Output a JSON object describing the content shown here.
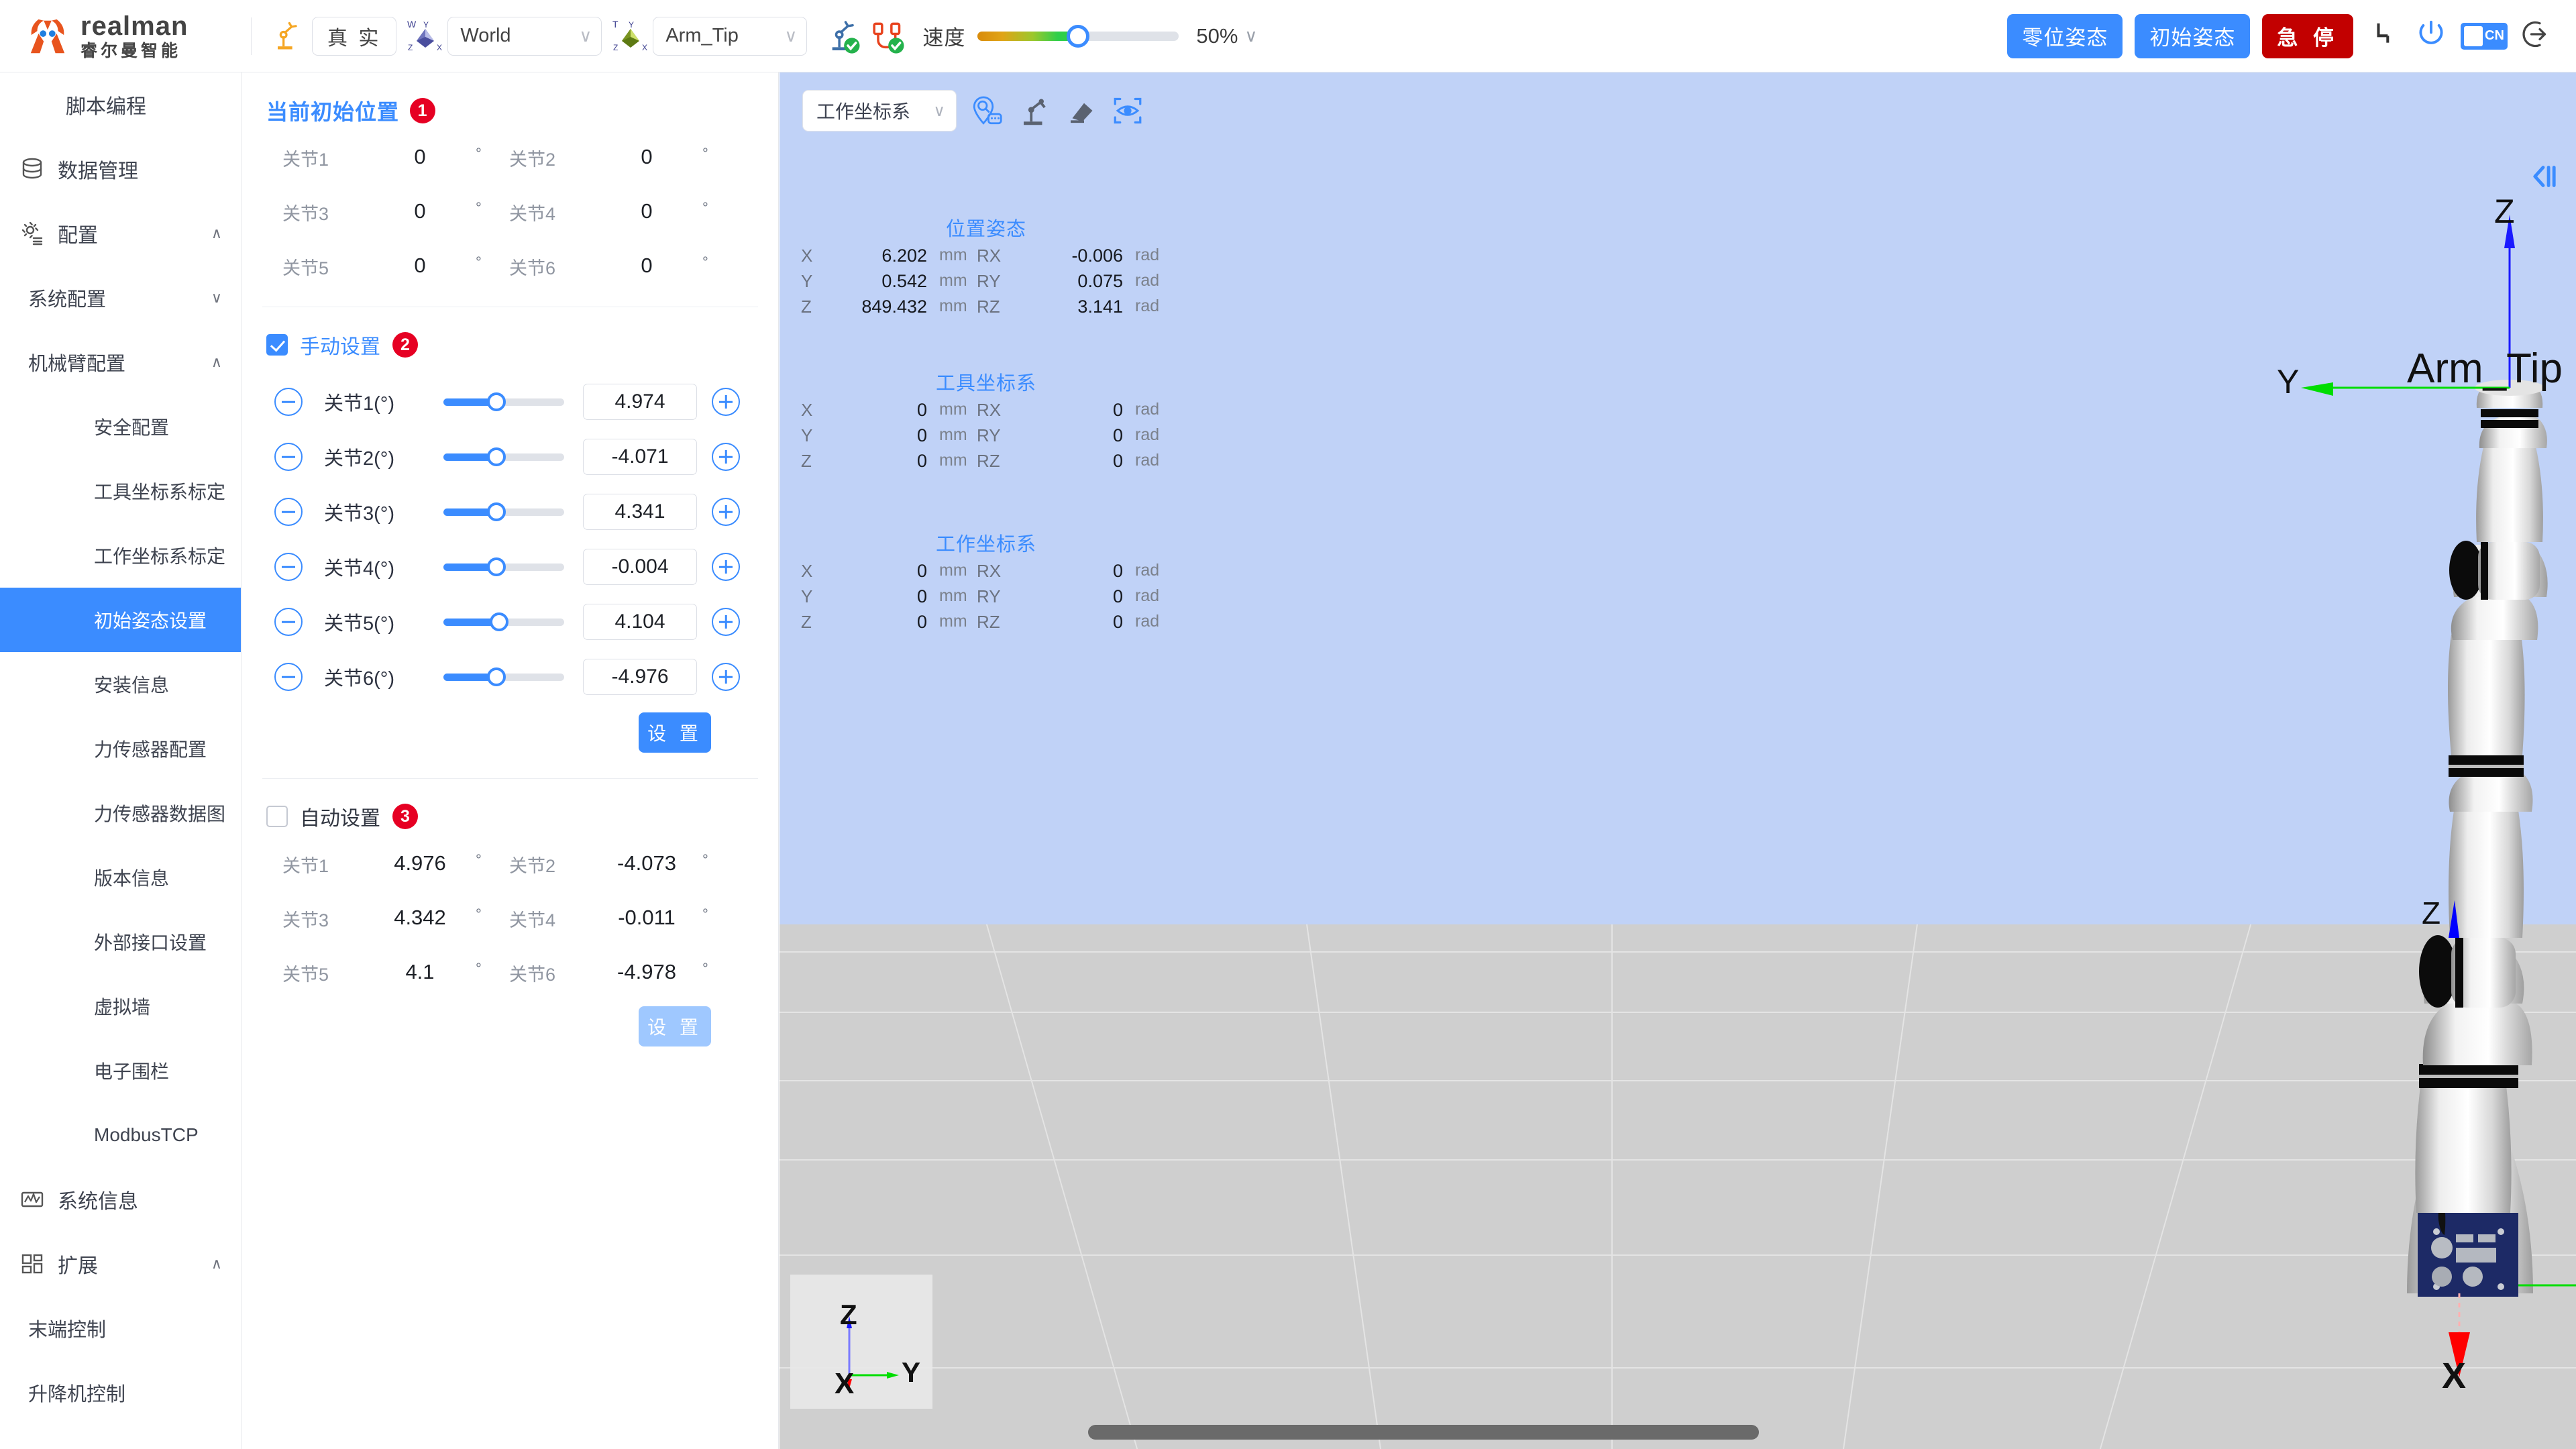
{
  "brand": {
    "name_en": "realman",
    "name_cn": "睿尔曼智能",
    "logo_icon": "realman-logo-icon"
  },
  "toolbar": {
    "robot_icon": "robot-arm-icon",
    "mode_button": "真 实",
    "world_frame": {
      "badge": "W",
      "icon": "world-axis-icon",
      "value": "World",
      "caret": "∨"
    },
    "tool_frame": {
      "badge": "T",
      "icon": "tool-axis-icon",
      "value": "Arm_Tip",
      "caret": "∨"
    },
    "status_icons": [
      {
        "name": "robot-connected-icon",
        "state": "ok"
      },
      {
        "name": "cable-connected-icon",
        "state": "ok"
      }
    ],
    "speed_label": "速度",
    "speed_value": "50%",
    "speed_percent": 50,
    "speed_caret": "∨",
    "actions": {
      "zero_pose": "零位姿态",
      "initial_pose": "初始姿态",
      "emergency_stop": "急 停"
    },
    "right_icons": [
      "joint-corner-icon",
      "power-icon",
      "language-toggle-icon",
      "logout-icon"
    ],
    "language": "CN"
  },
  "sidebar": {
    "items": [
      {
        "label": "脚本编程",
        "level": 0,
        "icon": "",
        "chevron": "",
        "active": false
      },
      {
        "label": "数据管理",
        "level": 0,
        "icon": "database-icon",
        "chevron": "",
        "active": false
      },
      {
        "label": "配置",
        "level": 0,
        "icon": "gear-config-icon",
        "chevron": "∧",
        "active": false
      },
      {
        "label": "系统配置",
        "level": 1,
        "icon": "",
        "chevron": "∨",
        "active": false
      },
      {
        "label": "机械臂配置",
        "level": 1,
        "icon": "",
        "chevron": "∧",
        "active": false
      },
      {
        "label": "安全配置",
        "level": 2,
        "icon": "",
        "chevron": "",
        "active": false
      },
      {
        "label": "工具坐标系标定",
        "level": 2,
        "icon": "",
        "chevron": "",
        "active": false
      },
      {
        "label": "工作坐标系标定",
        "level": 2,
        "icon": "",
        "chevron": "",
        "active": false
      },
      {
        "label": "初始姿态设置",
        "level": 2,
        "icon": "",
        "chevron": "",
        "active": true
      },
      {
        "label": "安装信息",
        "level": 2,
        "icon": "",
        "chevron": "",
        "active": false
      },
      {
        "label": "力传感器配置",
        "level": 2,
        "icon": "",
        "chevron": "",
        "active": false
      },
      {
        "label": "力传感器数据图",
        "level": 2,
        "icon": "",
        "chevron": "",
        "active": false
      },
      {
        "label": "版本信息",
        "level": 2,
        "icon": "",
        "chevron": "",
        "active": false
      },
      {
        "label": "外部接口设置",
        "level": 2,
        "icon": "",
        "chevron": "",
        "active": false
      },
      {
        "label": "虚拟墙",
        "level": 2,
        "icon": "",
        "chevron": "",
        "active": false
      },
      {
        "label": "电子围栏",
        "level": 2,
        "icon": "",
        "chevron": "",
        "active": false
      },
      {
        "label": "ModbusTCP",
        "level": 2,
        "icon": "",
        "chevron": "",
        "active": false
      },
      {
        "label": "系统信息",
        "level": 0,
        "icon": "chart-wave-icon",
        "chevron": "",
        "active": false
      },
      {
        "label": "扩展",
        "level": 0,
        "icon": "blocks-icon",
        "chevron": "∧",
        "active": false
      },
      {
        "label": "末端控制",
        "level": 1,
        "icon": "",
        "chevron": "",
        "active": false
      },
      {
        "label": "升降机控制",
        "level": 1,
        "icon": "",
        "chevron": "",
        "active": false
      }
    ]
  },
  "panel": {
    "current_position": {
      "title": "当前初始位置",
      "badge": "1",
      "unit": "°",
      "joints": [
        {
          "label": "关节1",
          "value": "0"
        },
        {
          "label": "关节2",
          "value": "0"
        },
        {
          "label": "关节3",
          "value": "0"
        },
        {
          "label": "关节4",
          "value": "0"
        },
        {
          "label": "关节5",
          "value": "0"
        },
        {
          "label": "关节6",
          "value": "0"
        }
      ]
    },
    "manual": {
      "title": "手动设置",
      "badge": "2",
      "checked": true,
      "set_button": "设 置",
      "sliders": [
        {
          "label": "关节1(°)",
          "value": "4.974",
          "percent": 44
        },
        {
          "label": "关节2(°)",
          "value": "-4.071",
          "percent": 44
        },
        {
          "label": "关节3(°)",
          "value": "4.341",
          "percent": 44
        },
        {
          "label": "关节4(°)",
          "value": "-0.004",
          "percent": 44
        },
        {
          "label": "关节5(°)",
          "value": "4.104",
          "percent": 46
        },
        {
          "label": "关节6(°)",
          "value": "-4.976",
          "percent": 44
        }
      ],
      "minus_icon": "minus-circle-icon",
      "plus_icon": "plus-circle-icon"
    },
    "auto": {
      "title": "自动设置",
      "badge": "3",
      "checked": false,
      "set_button": "设 置",
      "unit": "°",
      "joints": [
        {
          "label": "关节1",
          "value": "4.976"
        },
        {
          "label": "关节2",
          "value": "-4.073"
        },
        {
          "label": "关节3",
          "value": "4.342"
        },
        {
          "label": "关节4",
          "value": "-0.011"
        },
        {
          "label": "关节5",
          "value": "4.1"
        },
        {
          "label": "关节6",
          "value": "-4.978"
        }
      ]
    }
  },
  "viewport": {
    "frame_select": {
      "value": "工作坐标系",
      "caret": "∨"
    },
    "tools": [
      "point-search-icon",
      "robot-model-icon",
      "eraser-icon",
      "focus-eye-icon"
    ],
    "collapse_icon": "collapse-panel-icon",
    "cards": [
      {
        "title": "位置姿态",
        "rows": [
          {
            "axis": "X",
            "value": "6.202",
            "unit": "mm",
            "raxis": "RX",
            "rvalue": "-0.006",
            "runit": "rad"
          },
          {
            "axis": "Y",
            "value": "0.542",
            "unit": "mm",
            "raxis": "RY",
            "rvalue": "0.075",
            "runit": "rad"
          },
          {
            "axis": "Z",
            "value": "849.432",
            "unit": "mm",
            "raxis": "RZ",
            "rvalue": "3.141",
            "runit": "rad"
          }
        ]
      },
      {
        "title": "工具坐标系",
        "rows": [
          {
            "axis": "X",
            "value": "0",
            "unit": "mm",
            "raxis": "RX",
            "rvalue": "0",
            "runit": "rad"
          },
          {
            "axis": "Y",
            "value": "0",
            "unit": "mm",
            "raxis": "RY",
            "rvalue": "0",
            "runit": "rad"
          },
          {
            "axis": "Z",
            "value": "0",
            "unit": "mm",
            "raxis": "RZ",
            "rvalue": "0",
            "runit": "rad"
          }
        ]
      },
      {
        "title": "工作坐标系",
        "rows": [
          {
            "axis": "X",
            "value": "0",
            "unit": "mm",
            "raxis": "RX",
            "rvalue": "0",
            "runit": "rad"
          },
          {
            "axis": "Y",
            "value": "0",
            "unit": "mm",
            "raxis": "RY",
            "rvalue": "0",
            "runit": "rad"
          },
          {
            "axis": "Z",
            "value": "0",
            "unit": "mm",
            "raxis": "RZ",
            "rvalue": "0",
            "runit": "rad"
          }
        ]
      }
    ],
    "scene_labels": {
      "tool_tip": "Arm_Tip",
      "tip_z": "Z",
      "tip_y": "Y",
      "elbow_z": "Z",
      "world_y": "Y",
      "world_x": "X"
    },
    "axis_gizmo": {
      "z": "Z",
      "y": "Y",
      "x": "X"
    },
    "colors": {
      "axis_x": "#ff0000",
      "axis_y": "#00dd00",
      "axis_z": "#1a1aff",
      "sky": "#c0d2f7",
      "ground": "#cfcfcf"
    }
  },
  "colors": {
    "accent": "#3b8cff",
    "danger": "#c20000",
    "badge_red": "#e60023",
    "brand_orange": "#e8541e"
  }
}
